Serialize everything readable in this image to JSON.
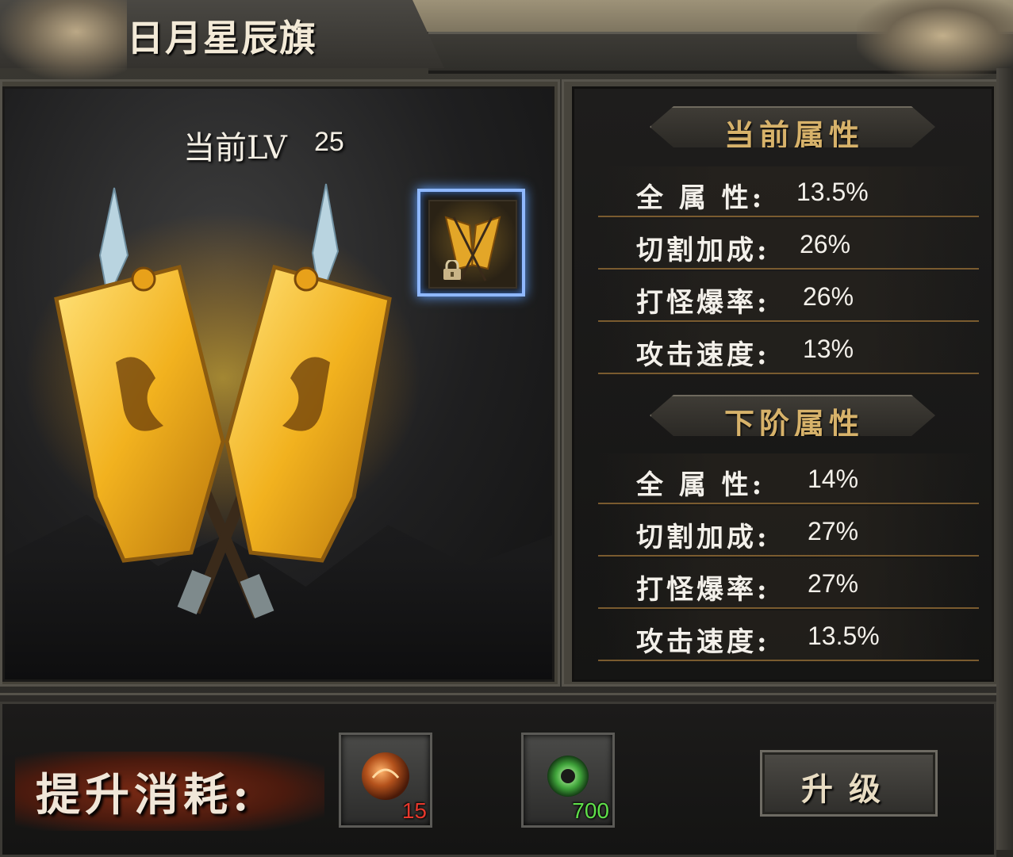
{
  "window": {
    "title": "日月星辰旗"
  },
  "display": {
    "level_label": "当前LV",
    "level_value": "25",
    "icon_name": "banner-icon",
    "lock_icon": "lock-icon"
  },
  "current_attributes": {
    "header": "当前属性",
    "rows": [
      {
        "label": "全 属 性:",
        "value": "13.5%"
      },
      {
        "label": "切割加成:",
        "value": "26%"
      },
      {
        "label": "打怪爆率:",
        "value": "26%"
      },
      {
        "label": "攻击速度:",
        "value": "13%"
      }
    ]
  },
  "next_attributes": {
    "header": "下阶属性",
    "rows": [
      {
        "label": "全 属 性:",
        "value": "14%"
      },
      {
        "label": "切割加成:",
        "value": "27%"
      },
      {
        "label": "打怪爆率:",
        "value": "27%"
      },
      {
        "label": "攻击速度:",
        "value": "13.5%"
      }
    ]
  },
  "cost": {
    "label": "提升消耗:",
    "items": [
      {
        "icon": "orb-icon",
        "count": "15",
        "count_color": "#e6382c"
      },
      {
        "icon": "jade-ring-icon",
        "count": "700",
        "count_color": "#5fe04a"
      }
    ]
  },
  "actions": {
    "upgrade_label": "升级"
  },
  "colors": {
    "header_gold": "#d7b26a",
    "stat_text": "#f3f0ea",
    "divider": "#7a5b2f",
    "slot_glow": "#5fa0ff"
  }
}
